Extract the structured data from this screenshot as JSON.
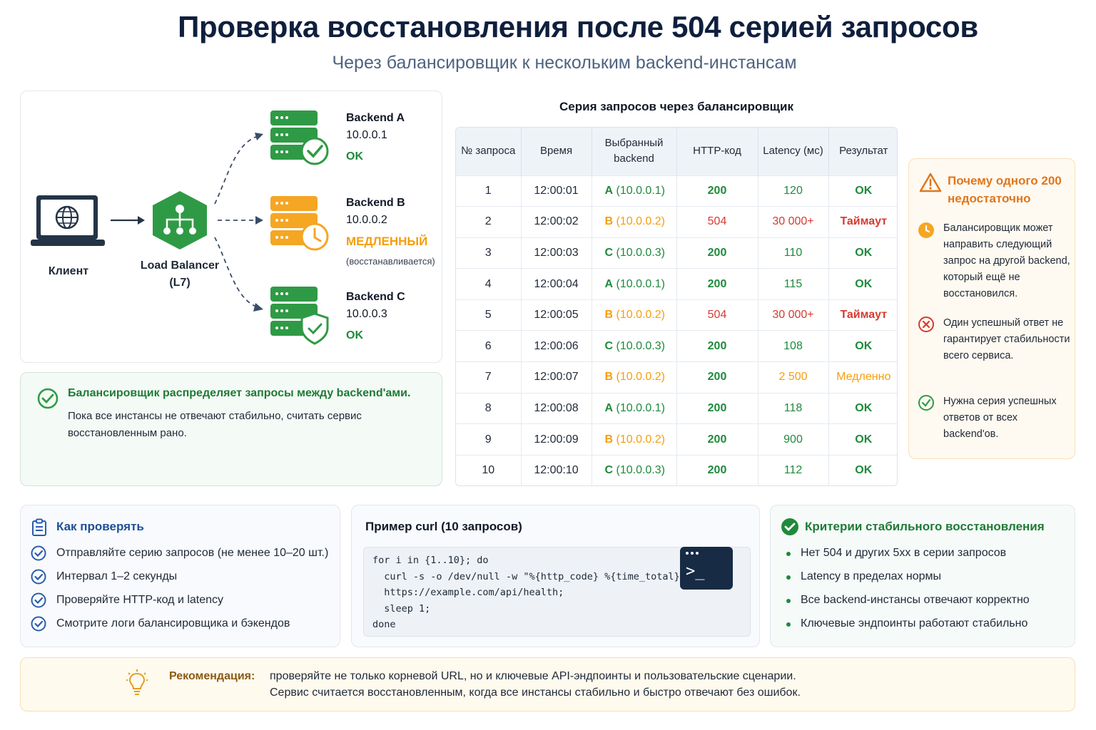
{
  "title": "Проверка восстановления после 504 серией запросов",
  "subtitle": "Через балансировщик к нескольким backend-инстансам",
  "diagram": {
    "client_label": "Клиент",
    "lb_label_1": "Load Balancer",
    "lb_label_2": "(L7)",
    "backends": [
      {
        "name": "Backend A",
        "ip": "10.0.0.1",
        "status": "OK"
      },
      {
        "name": "Backend B",
        "ip": "10.0.0.2",
        "status": "МЕДЛЕННЫЙ",
        "note": "(восстанавливается)"
      },
      {
        "name": "Backend C",
        "ip": "10.0.0.3",
        "status": "OK"
      }
    ],
    "colors": {
      "green": "#2f9a45",
      "orange": "#f5a623",
      "dark": "#243447"
    }
  },
  "lb_info": {
    "head": "Балансировщик распределяет запросы между backend'ами.",
    "body": "Пока все инстансы не отвечают стабильно, считать сервис восстановленным рано."
  },
  "table": {
    "title": "Серия запросов через балансировщик",
    "headers": [
      "№ запроса",
      "Время",
      "Выбранный backend",
      "HTTP-код",
      "Latency (мс)",
      "Результат"
    ],
    "rows": [
      {
        "n": "1",
        "time": "12:00:01",
        "be_letter": "A",
        "be_ip": "(10.0.0.1)",
        "code": "200",
        "latency": "120",
        "result": "OK",
        "state": "ok"
      },
      {
        "n": "2",
        "time": "12:00:02",
        "be_letter": "B",
        "be_ip": "(10.0.0.2)",
        "code": "504",
        "latency": "30 000+",
        "result": "Таймаут",
        "state": "err"
      },
      {
        "n": "3",
        "time": "12:00:03",
        "be_letter": "C",
        "be_ip": "(10.0.0.3)",
        "code": "200",
        "latency": "110",
        "result": "OK",
        "state": "ok"
      },
      {
        "n": "4",
        "time": "12:00:04",
        "be_letter": "A",
        "be_ip": "(10.0.0.1)",
        "code": "200",
        "latency": "115",
        "result": "OK",
        "state": "ok"
      },
      {
        "n": "5",
        "time": "12:00:05",
        "be_letter": "B",
        "be_ip": "(10.0.0.2)",
        "code": "504",
        "latency": "30 000+",
        "result": "Таймаут",
        "state": "err"
      },
      {
        "n": "6",
        "time": "12:00:06",
        "be_letter": "C",
        "be_ip": "(10.0.0.3)",
        "code": "200",
        "latency": "108",
        "result": "OK",
        "state": "ok"
      },
      {
        "n": "7",
        "time": "12:00:07",
        "be_letter": "B",
        "be_ip": "(10.0.0.2)",
        "code": "200",
        "latency": "2 500",
        "result": "Медленно",
        "state": "slow"
      },
      {
        "n": "8",
        "time": "12:00:08",
        "be_letter": "A",
        "be_ip": "(10.0.0.1)",
        "code": "200",
        "latency": "118",
        "result": "OK",
        "state": "ok"
      },
      {
        "n": "9",
        "time": "12:00:09",
        "be_letter": "B",
        "be_ip": "(10.0.0.2)",
        "code": "200",
        "latency": "900",
        "result": "OK",
        "state": "ok"
      },
      {
        "n": "10",
        "time": "12:00:10",
        "be_letter": "C",
        "be_ip": "(10.0.0.3)",
        "code": "200",
        "latency": "112",
        "result": "OK",
        "state": "ok"
      }
    ]
  },
  "why": {
    "head": "Почему одного 200 недостаточно",
    "items": [
      "Балансировщик может направить следующий запрос на другой backend, который ещё не восстановился.",
      "Один успешный ответ не гарантирует стабильности всего сервиса.",
      "Нужна серия успешных ответов от всех backend'ов."
    ]
  },
  "how": {
    "head": "Как проверять",
    "items": [
      "Отправляйте серию запросов (не менее 10–20 шт.)",
      "Интервал 1–2 секунды",
      "Проверяйте HTTP-код и latency",
      "Смотрите логи балансировщика и бэкендов"
    ]
  },
  "curl": {
    "head": "Пример curl (10 запросов)",
    "lines": [
      "for i in {1..10}; do",
      "  curl -s -o /dev/null -w \"%{http_code} %{time_total}n\" \\",
      "  https://example.com/api/health;",
      "  sleep 1;",
      "done"
    ],
    "prompt": ">_"
  },
  "criteria": {
    "head": "Критерии стабильного восстановления",
    "items": [
      "Нет 504 и других 5xx в серии запросов",
      "Latency в пределах нормы",
      "Все backend-инстансы отвечают корректно",
      "Ключевые эндпоинты работают стабильно"
    ]
  },
  "recommendation": {
    "label": "Рекомендация:",
    "line1": "проверяйте не только корневой URL, но и ключевые API-эндпоинты и пользовательские сценарии.",
    "line2": "Сервис считается восстановленным, когда все инстансы стабильно и быстро отвечают без ошибок."
  }
}
